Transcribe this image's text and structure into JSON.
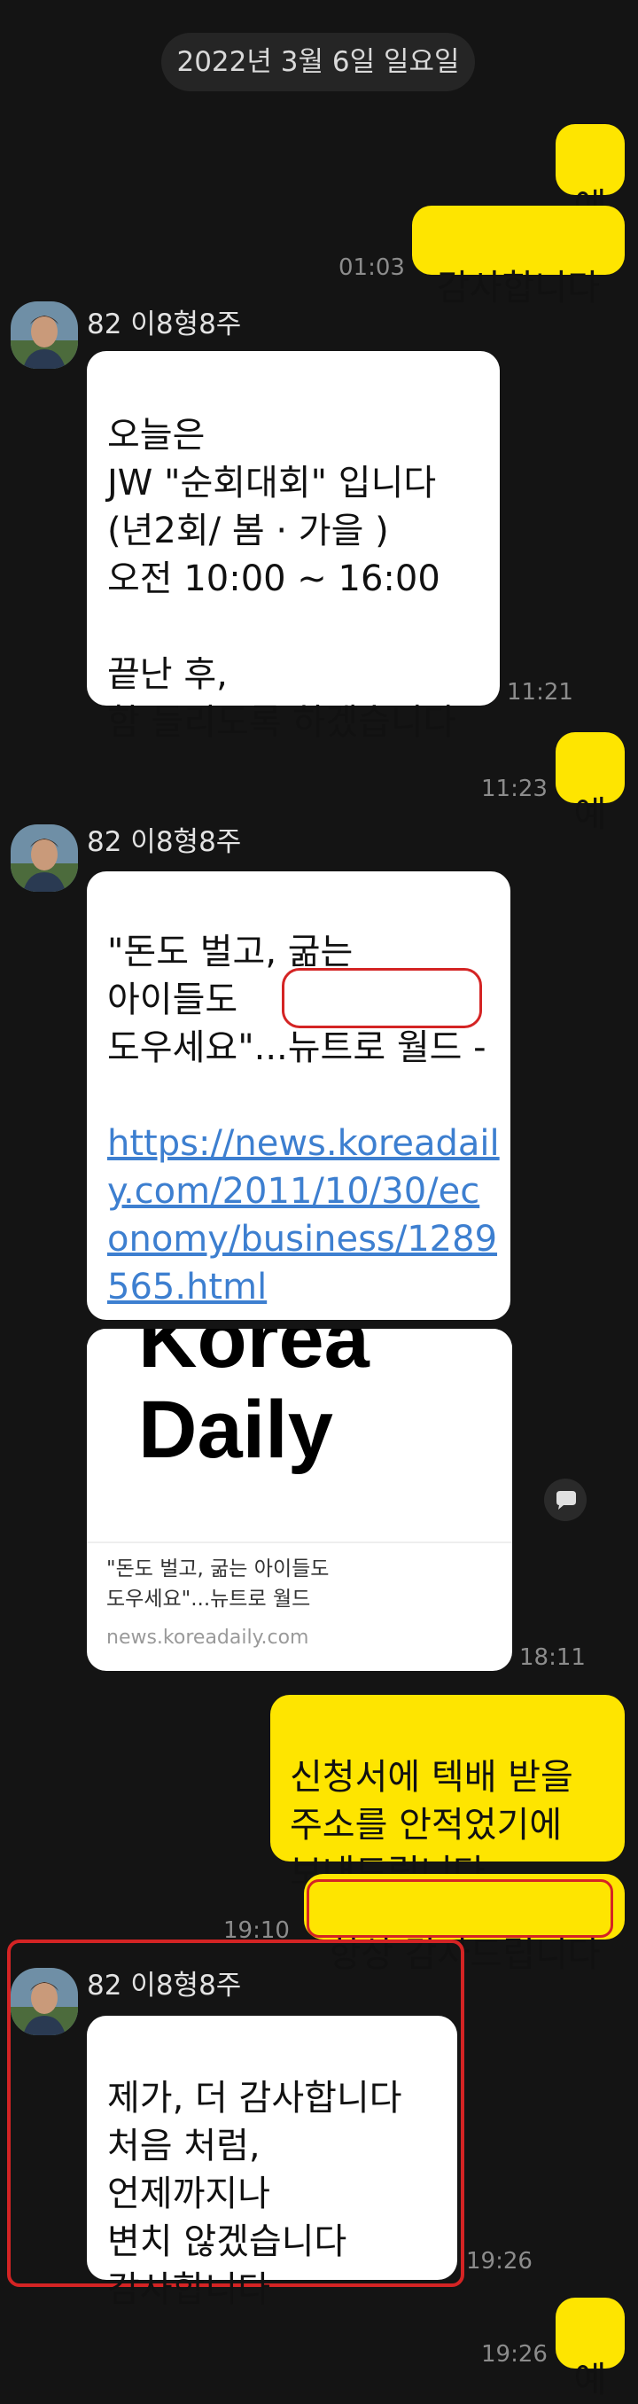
{
  "date_separator": "2022년 3월 6일 일요일",
  "sender_name": "82 이8형8주",
  "messages": {
    "m1": {
      "text": "예"
    },
    "m2": {
      "text": "감사합니다",
      "time": "01:03"
    },
    "m3": {
      "text": "오늘은\nJW \"순회대회\" 입니다\n (년2회/ 봄 · 가을 )\n오전 10:00 ~ 16:00\n\n끝난 후,\n함 들리도록 하겠습니다",
      "time": "11:21"
    },
    "m4": {
      "text": "예",
      "time": "11:23"
    },
    "m5": {
      "text_part1": "\"돈도 벌고, 굶는\n아이들도\n도우세요\"...",
      "highlight": "뉴트로 월드",
      "dash": " -",
      "link": "https://news.koreadaily.com/2011/10/30/economy/business/1289565.html"
    },
    "m6": {
      "preview_logo_line1": "Korea",
      "preview_logo_line2": "Daily",
      "preview_title": "\"돈도 벌고, 굶는 아이들도\n도우세요\"...뉴트로 월드",
      "preview_domain": "news.koreadaily.com",
      "time": "18:11"
    },
    "m7": {
      "text": "신청서에 텍배 받을\n주소를 안적었기에\n보내드립니다"
    },
    "m8": {
      "text": "항상 감사드립니다",
      "time": "19:10"
    },
    "m9": {
      "text": "제가, 더 감사합니다\n처음 처럼,\n언제까지나\n변치 않겠습니다\n감사합니다",
      "time": "19:26"
    },
    "m10": {
      "text": "예",
      "time": "19:26"
    }
  },
  "icons": {
    "share": "share-icon",
    "avatar": "profile-avatar"
  },
  "colors": {
    "background": "#141414",
    "my_bubble": "#fee500",
    "their_bubble": "#ffffff",
    "annotation": "#d42424",
    "link": "#3d7fd0"
  }
}
